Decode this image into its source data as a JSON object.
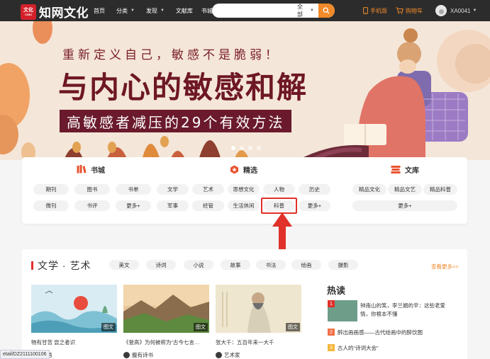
{
  "header": {
    "logo_badge": "文化",
    "logo_badge_sub": "CNKI",
    "logo_text": "知网文化",
    "nav": [
      {
        "label": "首页",
        "has_caret": false
      },
      {
        "label": "分类",
        "has_caret": true
      },
      {
        "label": "发现",
        "has_caret": true
      },
      {
        "label": "文献库",
        "has_caret": false
      },
      {
        "label": "书城",
        "has_caret": false
      }
    ],
    "search": {
      "placeholder": "",
      "scope": "全部"
    },
    "mobile": "手机版",
    "cart": "购物车",
    "username": "XA0041"
  },
  "banner": {
    "title1": "重新定义自己，敏感不是脆弱！",
    "title2": "与内心的敏感和解",
    "subtitle": "高敏感者减压的29个有效方法",
    "dots": 4,
    "active_dot": 0
  },
  "categories": {
    "shucheng": {
      "title": "书城",
      "items": [
        "期刊",
        "图书",
        "书单",
        "微刊",
        "书评",
        "更多+"
      ]
    },
    "jingxuan": {
      "title": "精选",
      "items": [
        "文学",
        "艺术",
        "思想文化",
        "人物",
        "历史",
        "军事",
        "经管",
        "生活休闲",
        "科普",
        "更多+"
      ],
      "highlighted": "科普"
    },
    "wenku": {
      "title": "文库",
      "items": [
        "精品文化",
        "精品文艺",
        "精品科普",
        "更多+"
      ]
    }
  },
  "literature": {
    "title": "文学 · 艺术",
    "tags": [
      "美文",
      "诗词",
      "小说",
      "故事",
      "书法",
      "绘画",
      "摄影"
    ],
    "more": "查看更多>>",
    "cards": [
      {
        "title": "物有甘苦 尝之者识",
        "source": "思·悟",
        "badge": "图文"
      },
      {
        "title": "《登高》为何被称为“古今七言…",
        "source": "腹有诗书",
        "badge": "图文"
      },
      {
        "title": "张大千：五百年来一大千",
        "source": "艺术家",
        "badge": "图文"
      }
    ],
    "hot": {
      "title": "热读",
      "items": [
        {
          "rank": "1",
          "text": "钟南山的笑，李兰娟的辛：这些老爱情，你根本不懂"
        },
        {
          "rank": "2",
          "text": "醉出画画感——古代绘画中的醉饮图"
        },
        {
          "rank": "3",
          "text": "古人的“诗词大会”"
        }
      ]
    }
  },
  "status_url": "etail/DZ2111100106",
  "colors": {
    "accent": "#f08a2a",
    "red": "#e0312a",
    "header_bg": "#2c2c2c",
    "banner_bg": "#f4e6d8"
  }
}
